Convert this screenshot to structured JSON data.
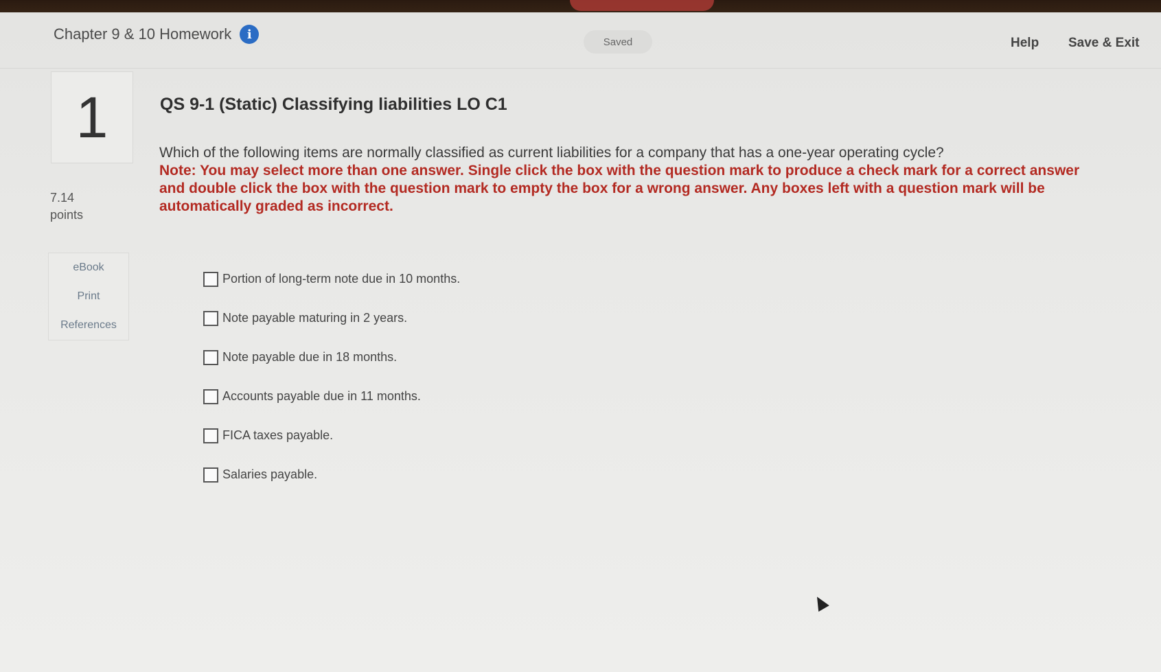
{
  "header": {
    "assignment_title": "Chapter 9 & 10 Homework",
    "info_icon": "info-icon",
    "saved_status": "Saved",
    "help_label": "Help",
    "save_exit_label": "Save & Exit"
  },
  "question": {
    "number": "1",
    "points_value": "7.14",
    "points_label": "points",
    "title": "QS 9-1 (Static) Classifying liabilities LO C1",
    "prompt": "Which of the following items are normally classified as current liabilities for a company that has a one-year operating cycle?",
    "note": "Note: You may select more than one answer. Single click the box with the question mark to produce a check mark for a correct answer and double click the box with the question mark to empty the box for a wrong answer. Any boxes left with a question mark will be automatically graded as incorrect."
  },
  "side_menu": {
    "items": [
      "eBook",
      "Print",
      "References"
    ]
  },
  "options": [
    {
      "label": "Portion of long-term note due in 10 months.",
      "checked": false
    },
    {
      "label": "Note payable maturing in 2 years.",
      "checked": false
    },
    {
      "label": "Note payable due in 18 months.",
      "checked": false
    },
    {
      "label": "Accounts payable due in 11 months.",
      "checked": false
    },
    {
      "label": "FICA taxes payable.",
      "checked": false
    },
    {
      "label": "Salaries payable.",
      "checked": false
    }
  ],
  "colors": {
    "note_red": "#b32a22",
    "info_blue": "#2b6cc4"
  }
}
